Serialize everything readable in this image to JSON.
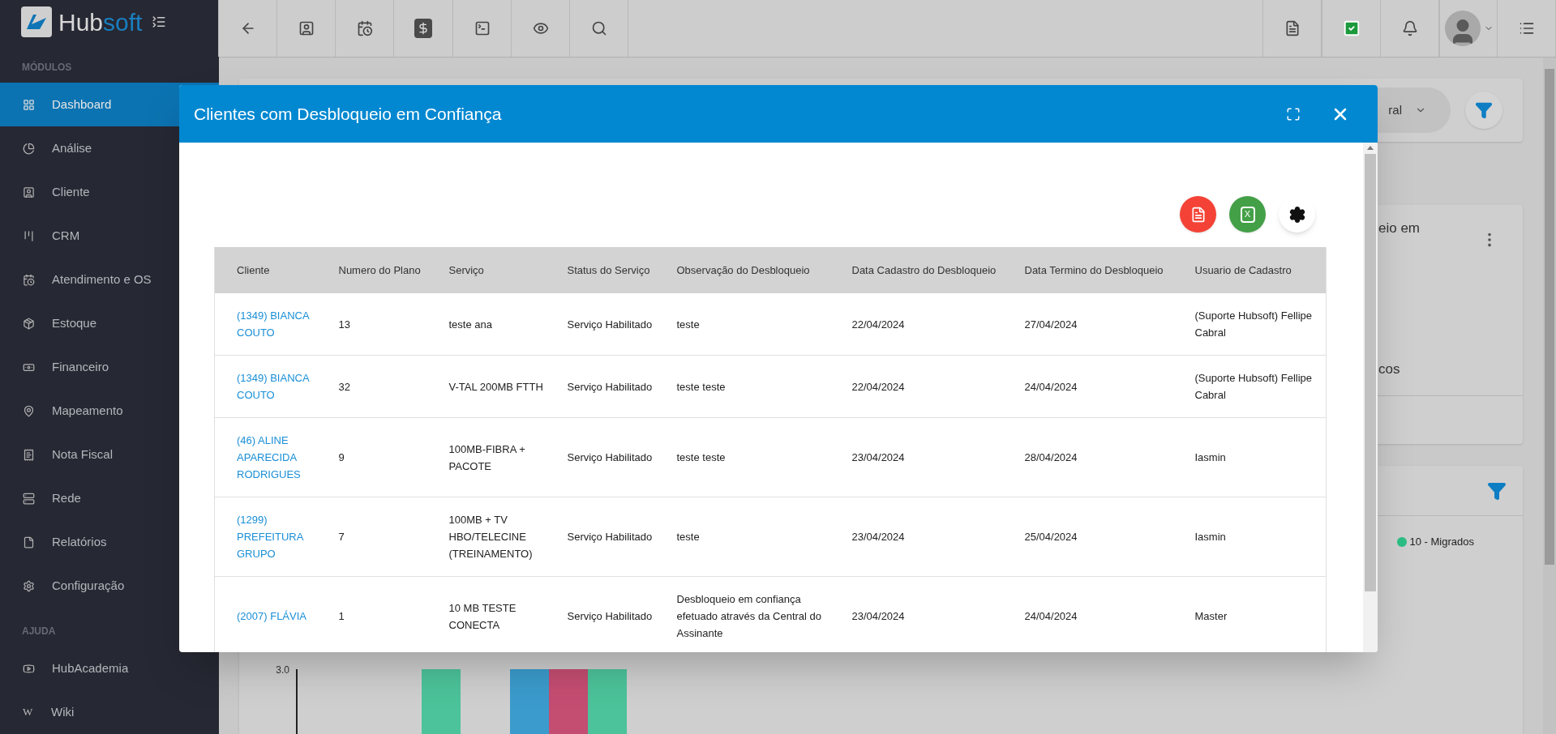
{
  "brand": {
    "part1": "Hub",
    "part2": "soft"
  },
  "sidebar": {
    "sections": [
      {
        "title": "MÓDULOS",
        "items": [
          {
            "label": "Dashboard",
            "selected": true
          },
          {
            "label": "Análise",
            "selected": false
          },
          {
            "label": "Cliente",
            "selected": false
          },
          {
            "label": "CRM",
            "selected": false
          },
          {
            "label": "Atendimento e OS",
            "selected": false
          },
          {
            "label": "Estoque",
            "selected": false
          },
          {
            "label": "Financeiro",
            "selected": false
          },
          {
            "label": "Mapeamento",
            "selected": false
          },
          {
            "label": "Nota Fiscal",
            "selected": false
          },
          {
            "label": "Rede",
            "selected": false
          },
          {
            "label": "Relatórios",
            "selected": false
          },
          {
            "label": "Configuração",
            "selected": false
          }
        ]
      },
      {
        "title": "AJUDA",
        "items": [
          {
            "label": "HubAcademia",
            "selected": false
          },
          {
            "label": "Wiki",
            "glyph": "W",
            "selected": false
          }
        ]
      }
    ]
  },
  "background": {
    "select_value": "ral",
    "card_title": "eio em",
    "card_caption": "cos",
    "legend": [
      {
        "label": "10 - Migrados",
        "color": "#2bbf85"
      }
    ],
    "axis_tick": "3.0"
  },
  "modal": {
    "title": "Clientes com Desbloqueio em Confiança",
    "excel_label": "X",
    "columns": [
      "Cliente",
      "Numero do Plano",
      "Serviço",
      "Status do Serviço",
      "Observação do Desbloqueio",
      "Data Cadastro do Desbloqueio",
      "Data Termino do Desbloqueio",
      "Usuario de Cadastro"
    ],
    "rows": [
      {
        "cells": [
          "(1349) BIANCA COUTO",
          "13",
          "teste ana",
          "Serviço Habilitado",
          "teste",
          "22/04/2024",
          "27/04/2024",
          "(Suporte Hubsoft) Fellipe Cabral"
        ]
      },
      {
        "cells": [
          "(1349) BIANCA COUTO",
          "32",
          "V-TAL 200MB FTTH",
          "Serviço Habilitado",
          "teste teste",
          "22/04/2024",
          "24/04/2024",
          "(Suporte Hubsoft) Fellipe Cabral"
        ]
      },
      {
        "cells": [
          "(46) ALINE APARECIDA RODRIGUES",
          "9",
          "100MB-FIBRA + PACOTE",
          "Serviço Habilitado",
          "teste teste",
          "23/04/2024",
          "28/04/2024",
          "Iasmin"
        ]
      },
      {
        "cells": [
          "(1299) PREFEITURA GRUPO",
          "7",
          "100MB + TV HBO/TELECINE (TREINAMENTO)",
          "Serviço Habilitado",
          "teste",
          "23/04/2024",
          "25/04/2024",
          "Iasmin"
        ]
      },
      {
        "cells": [
          "(2007) FLÁVIA",
          "1",
          "10 MB TESTE CONECTA",
          "Serviço Habilitado",
          "Desbloqueio em confiança efetuado através da Central do Assinante",
          "23/04/2024",
          "24/04/2024",
          "Master"
        ]
      }
    ]
  }
}
